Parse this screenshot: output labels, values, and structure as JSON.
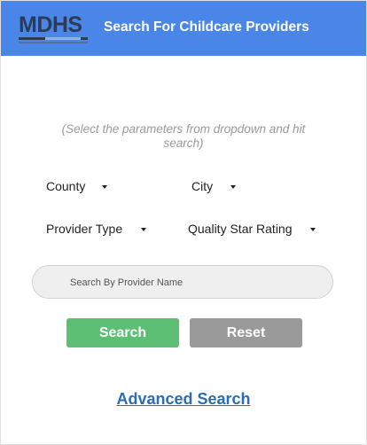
{
  "header": {
    "logo_text": "MDHS",
    "title": "Search For Childcare Providers",
    "color": "#4a86e8"
  },
  "instruction": "(Select the parameters from dropdown and hit search)",
  "filters": {
    "county_label": "County",
    "city_label": "City",
    "provider_type_label": "Provider Type",
    "quality_star_label": "Quality Star Rating"
  },
  "search": {
    "placeholder": "Search By Provider Name",
    "value": ""
  },
  "buttons": {
    "search_label": "Search",
    "search_color": "#5cbf73",
    "reset_label": "Reset",
    "reset_color": "#9a9a9a"
  },
  "advanced_search_label": "Advanced Search",
  "link_color": "#2a6cb6"
}
